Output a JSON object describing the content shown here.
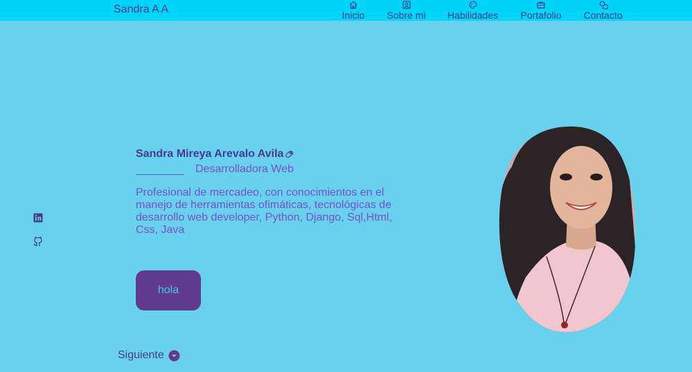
{
  "header": {
    "brand": "Sandra A A",
    "nav": [
      {
        "label": "Inicio",
        "icon": "home-icon"
      },
      {
        "label": "Sobre mi",
        "icon": "user-card-icon"
      },
      {
        "label": "Habilidades",
        "icon": "palette-icon"
      },
      {
        "label": "Portafolio",
        "icon": "briefcase-icon"
      },
      {
        "label": "Contacto",
        "icon": "chat-icon"
      }
    ]
  },
  "social": [
    {
      "icon": "linkedin-icon"
    },
    {
      "icon": "github-icon"
    }
  ],
  "hero": {
    "name": "Sandra Mireya Arevalo Avila",
    "name_icon": "waving-hand-icon",
    "role": "Desarrolladora Web",
    "description": "Profesional de mercadeo, con conocimientos en el manejo de herramientas ofimáticas, tecnológicas de desarrollo web developer, Python, Django, Sql,Html, Css, Java",
    "button_label": "hola",
    "photo_icon": "profile-photo"
  },
  "next": {
    "label": "Siguiente",
    "icon": "chevron-down-circle-icon"
  },
  "colors": {
    "background": "#68d1ee",
    "header": "#00d4f8",
    "primary": "#613a8e",
    "title": "#4a3a8c",
    "text": "#7a4fc9"
  }
}
